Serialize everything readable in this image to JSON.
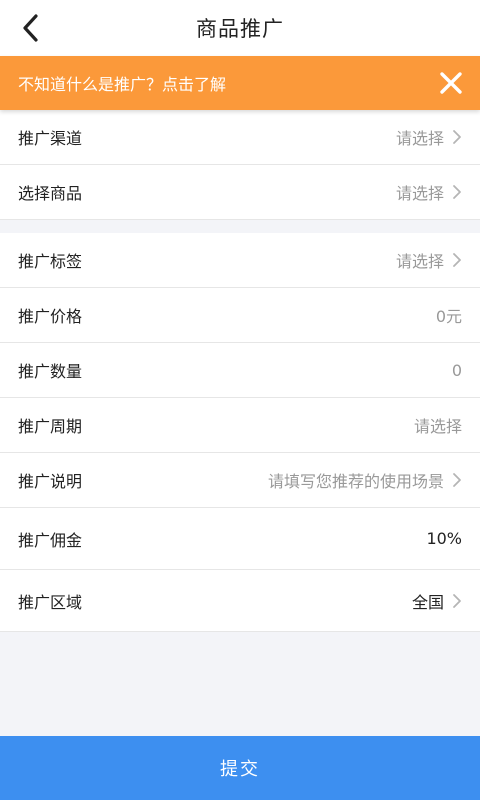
{
  "header": {
    "title": "商品推广",
    "back_icon": "chevron-left-icon"
  },
  "banner": {
    "text": "不知道什么是推广？点击了解",
    "close_icon": "close-icon",
    "color": "#fb993a"
  },
  "group1": {
    "channel": {
      "label": "推广渠道",
      "value": "请选择"
    },
    "product": {
      "label": "选择商品",
      "value": "请选择"
    }
  },
  "group2": {
    "tag": {
      "label": "推广标签",
      "value": "请选择"
    },
    "price": {
      "label": "推广价格",
      "value": "0元"
    },
    "quantity": {
      "label": "推广数量",
      "value": "0"
    },
    "period": {
      "label": "推广周期",
      "value": "请选择"
    },
    "description": {
      "label": "推广说明",
      "value": "请填写您推荐的使用场景"
    },
    "commission": {
      "label": "推广佣金",
      "value": "10%"
    },
    "region": {
      "label": "推广区域",
      "value": "全国"
    }
  },
  "submit": {
    "label": "提交",
    "color": "#3d8ff0"
  }
}
